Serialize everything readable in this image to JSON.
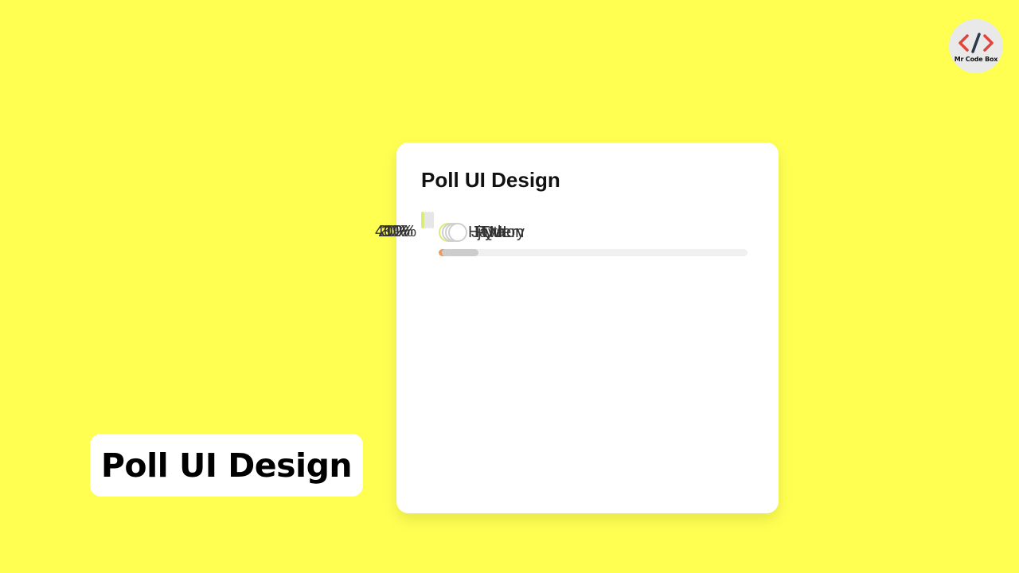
{
  "logo": {
    "icon": "code-brackets-icon",
    "text": "Mr Code Box"
  },
  "caption": {
    "text": "Poll UI Design"
  },
  "poll": {
    "title": "Poll UI Design",
    "options": [
      {
        "label": "HTML",
        "percent_text": "40%",
        "percent": 40,
        "selected": true
      },
      {
        "label": "Java",
        "percent_text": "20%",
        "percent": 20,
        "selected": false
      },
      {
        "label": "Python",
        "percent_text": "30%",
        "percent": 30,
        "selected": false
      },
      {
        "label": "jQuery",
        "percent_text": "10%",
        "percent": 10,
        "selected": false
      }
    ]
  },
  "colors": {
    "background": "#ffff52",
    "selected_border": "#d9ec7a",
    "selected_dot": "#ef8a6b",
    "selected_bar": "#e89b60",
    "unselected_bar": "#cccccc"
  }
}
